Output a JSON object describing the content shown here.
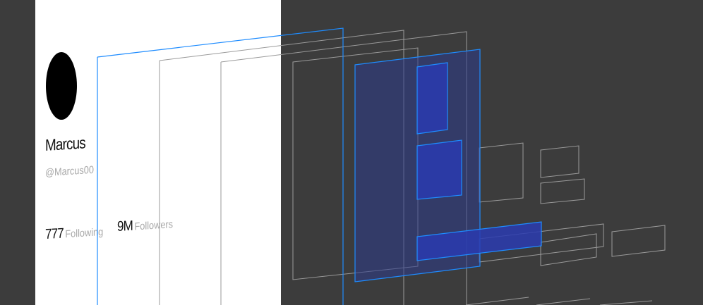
{
  "profile": {
    "name": "Marcus",
    "handle": "@Marcus00",
    "following_count": "777",
    "following_label": "Following",
    "followers_count": "9M",
    "followers_label": "Followers"
  },
  "colors": {
    "canvas": "#3c3c3c",
    "panel": "#ffffff",
    "selection_stroke": "#1e8cff",
    "selection_fill": "#2b3a8c",
    "wireframe": "#9a9a9a"
  }
}
